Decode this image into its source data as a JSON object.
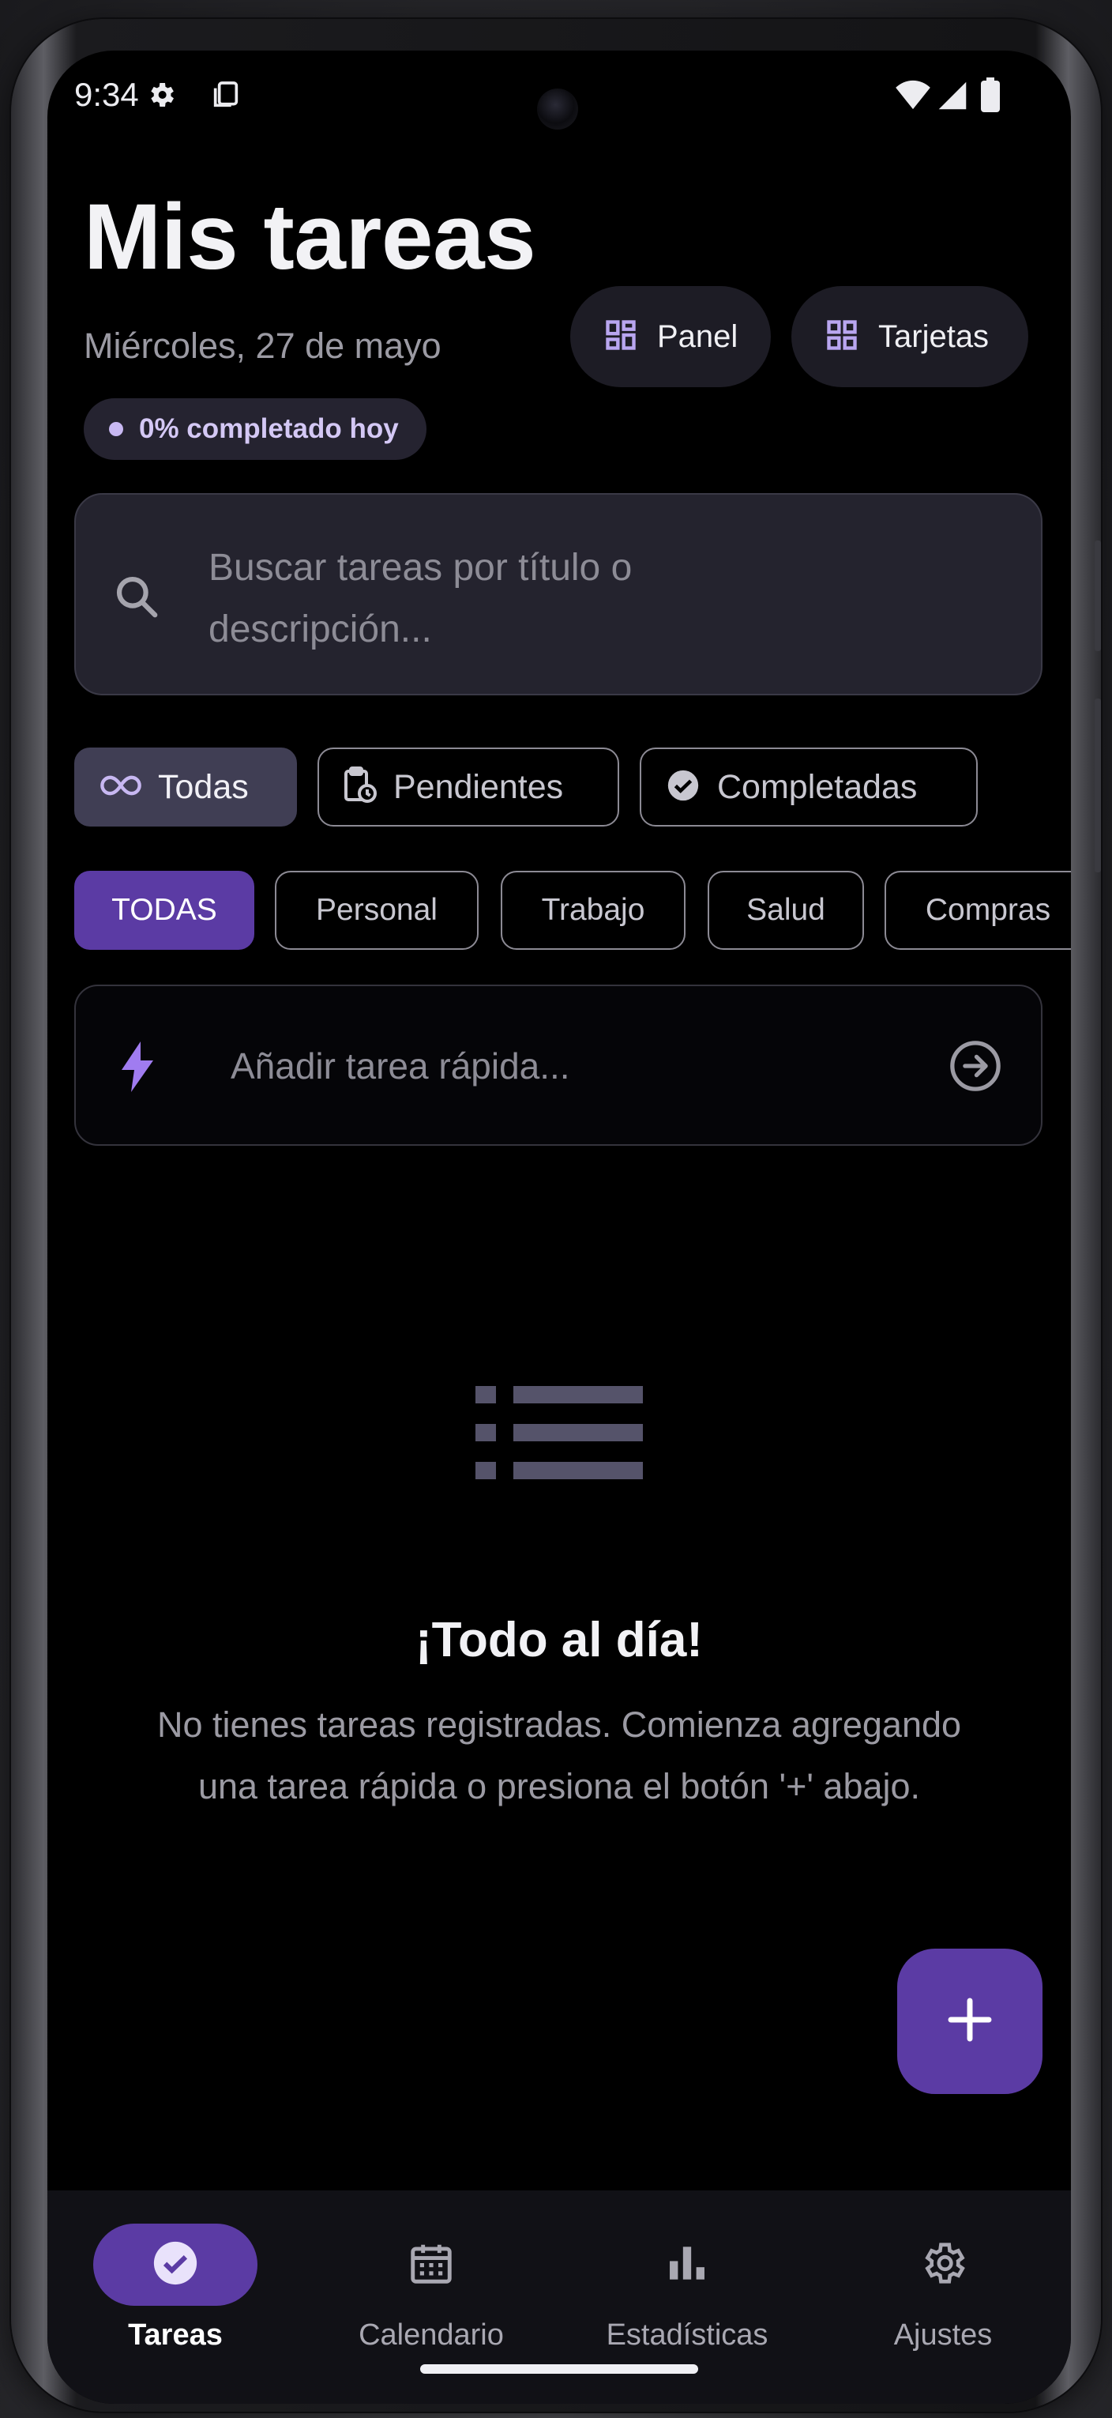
{
  "status_bar": {
    "time": "9:34",
    "icons": [
      "settings-gear-icon",
      "screenshot-icon",
      "wifi-icon",
      "cell-signal-icon",
      "battery-icon"
    ]
  },
  "header": {
    "title": "Mis tareas",
    "date": "Miércoles, 27 de mayo",
    "progress_badge": "0% completado hoy",
    "view_buttons": [
      {
        "label": "Panel",
        "icon": "grid-view-icon"
      },
      {
        "label": "Tarjetas",
        "icon": "grid-view-icon"
      }
    ]
  },
  "search": {
    "placeholder": "Buscar tareas por título o descripción...",
    "icon": "search-icon"
  },
  "status_filters": {
    "selected": "Todas",
    "items": [
      {
        "label": "Todas",
        "icon": "infinity-icon"
      },
      {
        "label": "Pendientes",
        "icon": "clipboard-clock-icon"
      },
      {
        "label": "Completadas",
        "icon": "check-circle-icon"
      }
    ]
  },
  "category_filters": {
    "selected": "TODAS",
    "items": [
      "TODAS",
      "Personal",
      "Trabajo",
      "Salud",
      "Compras"
    ]
  },
  "quick_add": {
    "placeholder": "Añadir tarea rápida...",
    "icon": "bolt-icon",
    "submit_icon": "arrow-right-circle-icon"
  },
  "empty_state": {
    "icon": "list-icon",
    "title": "¡Todo al día!",
    "message": "No tienes tareas registradas. Comienza agregando una tarea rápida o presiona el botón '+' abajo."
  },
  "fab": {
    "icon": "plus-icon"
  },
  "bottom_nav": {
    "selected": "Tareas",
    "items": [
      {
        "label": "Tareas",
        "icon": "check-circle-icon"
      },
      {
        "label": "Calendario",
        "icon": "calendar-icon"
      },
      {
        "label": "Estadísticas",
        "icon": "bar-chart-icon"
      },
      {
        "label": "Ajustes",
        "icon": "gear-icon"
      }
    ]
  },
  "colors": {
    "accent": "#5b3ba4",
    "accent_light": "#b9a6f0",
    "background": "#000000",
    "surface": "#24232e",
    "text_primary": "#f2f2f5",
    "text_secondary": "#9b9aa3"
  }
}
